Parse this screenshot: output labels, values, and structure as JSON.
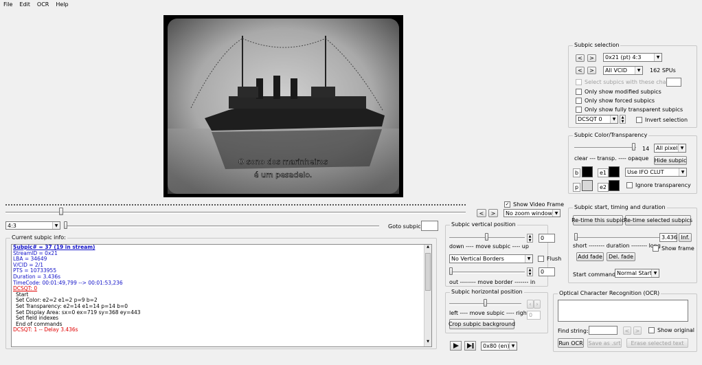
{
  "menu": [
    "File",
    "Edit",
    "OCR",
    "Help"
  ],
  "subtitle_overlay": [
    "O sono dos marinheiros",
    "é um pesadelo."
  ],
  "aspect": "4:3",
  "goto_label": "Goto subpic:",
  "goto_value": "",
  "nav_prev": "<",
  "nav_next": ">",
  "show_video_frame": {
    "label": "Show Video Frame",
    "checked": true
  },
  "zoom_combo": "No zoom window",
  "current_info": {
    "title": "Current subpic info:",
    "lines": [
      {
        "text": "Subpic# = 37 (19 in stream)",
        "style": "blue-bold"
      },
      {
        "text": "StreamID = 0x21",
        "style": "blue"
      },
      {
        "text": "LBA = 34649",
        "style": "blue"
      },
      {
        "text": "V/CID = 2/1",
        "style": "blue"
      },
      {
        "text": "PTS = 10733955",
        "style": "blue"
      },
      {
        "text": "Duration = 3.436s",
        "style": "blue"
      },
      {
        "text": "TimeCode: 00:01:49,799 --> 00:01:53,236",
        "style": "blue"
      },
      {
        "text": "DCSQT: 0",
        "style": "red-u"
      },
      {
        "text": "Start",
        "style": "indent"
      },
      {
        "text": "Set Color: e2=2 e1=2 p=9 b=2",
        "style": "indent"
      },
      {
        "text": "Set Transparency: e2=14 e1=14 p=14 b=0",
        "style": "indent"
      },
      {
        "text": "Set Display Area: sx=0 ex=719 sy=368 ey=443",
        "style": "indent"
      },
      {
        "text": "Set field indexes",
        "style": "indent"
      },
      {
        "text": "End of commands",
        "style": "indent"
      },
      {
        "text": "DCSQT: 1 -- Delay 3.436s",
        "style": "red"
      }
    ]
  },
  "subpic_selection": {
    "title": "Subpic selection",
    "stream_combo": "0x21 (pt) 4:3",
    "vcid_combo": "All VCID",
    "spu_count": "162 SPUs",
    "chars_label": "Select subpics with these chars",
    "chk_modified": "Only show modified subpics",
    "chk_forced": "Only show forced subpics",
    "chk_transparent": "Only show fully transparent subpics",
    "dcsqt_combo": "DCSQT 0",
    "invert_label": "Invert selection"
  },
  "color_transparency": {
    "title": "Subpic Color/Transparency",
    "level": "14",
    "pixels_combo": "All pixels",
    "scale_label": "clear --- transp. ---- opaque",
    "hide_btn": "Hide subpic",
    "b_label": "b",
    "e1_label": "e1",
    "p_label": "p",
    "e2_label": "e2",
    "clut_combo": "Use IFO CLUT",
    "ignore_label": "Ignore transparency",
    "b_color": "#000000",
    "e1_color": "#000000",
    "p_color": "#d8d8d8",
    "e2_color": "#000000"
  },
  "timing": {
    "title": "Subpic start, timing and duration",
    "retime_btn": "Re-time this subpic",
    "retime_sel_btn": "Re-time selected subpics",
    "duration_value": "3.436",
    "inf_btn": "Inf.",
    "scale_label": "short -------- duration -------- long",
    "show_frame": "Show frame",
    "add_fade": "Add fade",
    "del_fade": "Del. fade",
    "start_cmd_label": "Start command:",
    "start_cmd_combo": "Normal Start"
  },
  "vertical": {
    "title": "Subpic vertical position",
    "value": "0",
    "scale_label": "down ---- move subpic ---- up",
    "borders_combo": "No Vertical Borders",
    "flush_label": "Flush",
    "border_value": "0",
    "border_scale": "out -------- move border ------- in"
  },
  "horizontal": {
    "title": "Subpic horizontal position",
    "scale_label": "left ---- move subpic ---- right",
    "value": "0",
    "crop_btn": "Crop subpic background"
  },
  "ocr": {
    "title": "Optical Character Recognition (OCR)",
    "find_label": "Find string:",
    "show_original": "Show original",
    "run_btn": "Run OCR",
    "save_btn": "Save as .srt",
    "erase_btn": "Erase selected text"
  },
  "language_combo": "0x80 (en)"
}
